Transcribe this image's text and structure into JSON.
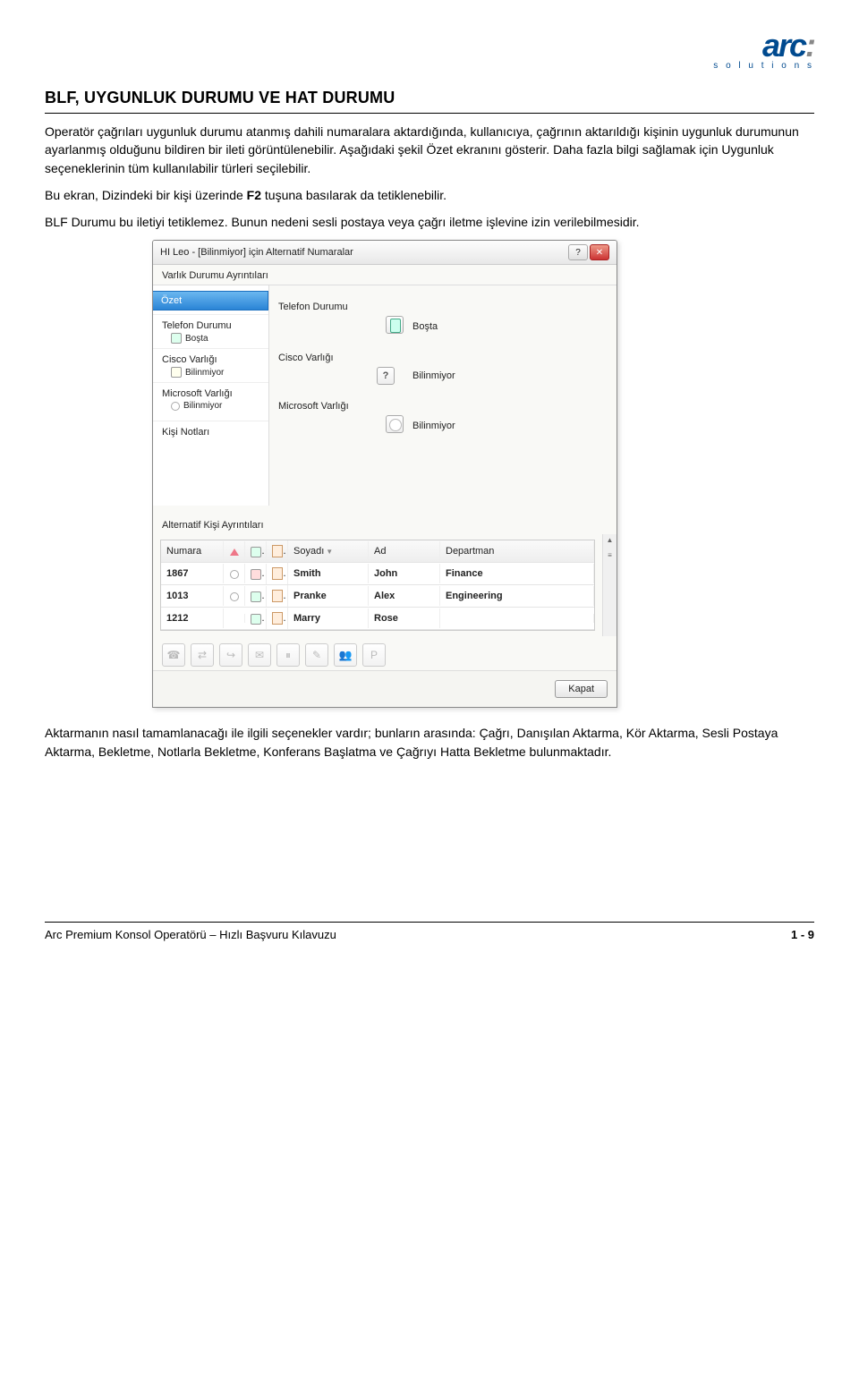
{
  "logo": {
    "name": "arc",
    "sub": "s o l u t i o n s"
  },
  "heading": "BLF, UYGUNLUK DURUMU VE HAT DURUMU",
  "para1": "Operatör çağrıları uygunluk durumu atanmış dahili numaralara aktardığında, kullanıcıya, çağrının aktarıldığı kişinin uygunluk durumunun ayarlanmış olduğunu bildiren bir ileti görüntülenebilir. Aşağıdaki şekil Özet ekranını gösterir. Daha fazla bilgi sağlamak için Uygunluk seçeneklerinin tüm kullanılabilir türleri seçilebilir.",
  "para2_a": "Bu ekran, Dizindeki bir kişi üzerinde ",
  "para2_bold": "F2",
  "para2_b": " tuşuna basılarak da tetiklenebilir.",
  "para3": "BLF Durumu bu iletiyi tetiklemez. Bunun nedeni sesli postaya veya çağrı iletme işlevine izin verilebilmesidir.",
  "dialog": {
    "title": "HI Leo - [Bilinmiyor] için Alternatif Numaralar",
    "section_presence": "Varlık Durumu Ayrıntıları",
    "sidebar": {
      "ozet": "Özet",
      "telefon_durumu": "Telefon Durumu",
      "bosta": "Boşta",
      "cisco_varligi": "Cisco Varlığı",
      "bilinmiyor": "Bilinmiyor",
      "microsoft_varligi": "Microsoft Varlığı",
      "kisi_notlari": "Kişi Notları"
    },
    "detail": {
      "telefon_label": "Telefon Durumu",
      "telefon_val": "Boşta",
      "cisco_label": "Cisco Varlığı",
      "cisco_val": "Bilinmiyor",
      "ms_label": "Microsoft Varlığı",
      "ms_val": "Bilinmiyor"
    },
    "section_alt": "Alternatif Kişi Ayrıntıları",
    "columns": {
      "numara": "Numara",
      "soyadi": "Soyadı",
      "ad": "Ad",
      "departman": "Departman"
    },
    "rows": [
      {
        "num": "1867",
        "last": "Smith",
        "first": "John",
        "dept": "Finance"
      },
      {
        "num": "1013",
        "last": "Pranke",
        "first": "Alex",
        "dept": "Engineering"
      },
      {
        "num": "1212",
        "last": "Marry",
        "first": "Rose",
        "dept": ""
      }
    ],
    "close_btn": "Kapat"
  },
  "para4": "Aktarmanın nasıl tamamlanacağı ile ilgili seçenekler vardır; bunların arasında: Çağrı, Danışılan Aktarma, Kör Aktarma, Sesli Postaya Aktarma, Bekletme, Notlarla Bekletme, Konferans Başlatma ve Çağrıyı Hatta Bekletme bulunmaktadır.",
  "footer": {
    "left": "Arc Premium Konsol Operatörü – Hızlı Başvuru Kılavuzu",
    "right": "1 - 9"
  }
}
